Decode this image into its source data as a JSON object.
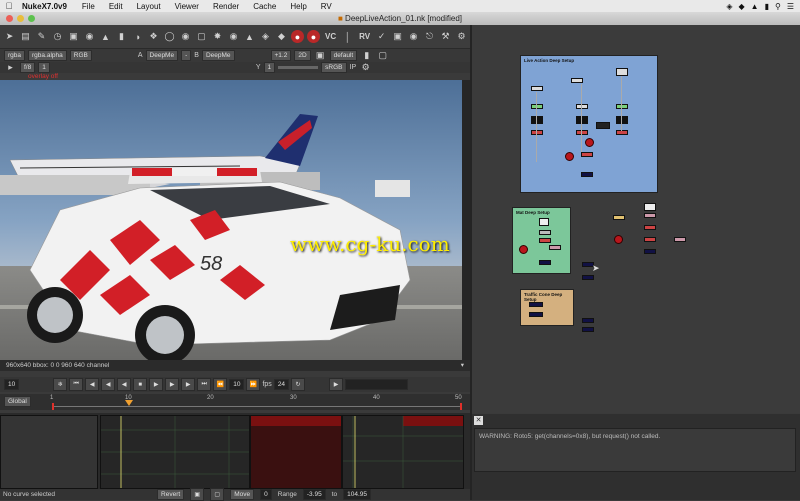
{
  "menubar": {
    "app_name": "NukeX7.0v9",
    "items": [
      "File",
      "Edit",
      "Layout",
      "Viewer",
      "Render",
      "Cache",
      "Help",
      "RV"
    ]
  },
  "window": {
    "title": "DeepLiveAction_01.nk [modified]"
  },
  "toolbar": {
    "vc_label": "VC",
    "rv_label": "RV"
  },
  "viewer_controls": {
    "channels": "rgba",
    "alpha": "rgba.alpha",
    "display": "RGB",
    "input_a_label": "A",
    "input_a": "DeepMe",
    "input_a_op": "-",
    "input_b_label": "B",
    "input_b": "DeepMe",
    "gain": "+1.2",
    "mode": "2D",
    "lut": "default",
    "frame": "f/8",
    "frame_value": "1",
    "y_label": "Y",
    "y_value": "1",
    "colorspace": "sRGB",
    "ip_label": "IP",
    "warning": "overlay off"
  },
  "viewer": {
    "status": "960x640 bbox: 0 0 960 640 channel"
  },
  "playback": {
    "current_frame": "10",
    "step": "10",
    "fps_label": "fps",
    "fps": "24",
    "range_mode": "Global"
  },
  "timeline": {
    "ticks": [
      "1",
      "10",
      "20",
      "30",
      "40",
      "50"
    ]
  },
  "bottombar": {
    "status": "No curve selected",
    "revert": "Revert",
    "move": "Move",
    "move_value": "0",
    "range_label": "Range",
    "range_from": "-3.95",
    "range_to_label": "to",
    "range_to": "104.95"
  },
  "nodegraph": {
    "backdrops": [
      {
        "title": "Live Action Deep Setup"
      },
      {
        "title": "Mat Deep Setup"
      },
      {
        "title": "Traffic Cone Deep Setup"
      }
    ]
  },
  "messages": {
    "warning": "WARNING: Roto5: get(channels=0x8), but request() not called."
  },
  "colors": {
    "accent_red": "#b92828",
    "backdrop_blue": "#7fa3d4",
    "backdrop_green": "#7cc79a",
    "backdrop_tan": "#d4b07f",
    "watermark": "#ffee00"
  },
  "watermark": "www.cg-ku.com"
}
